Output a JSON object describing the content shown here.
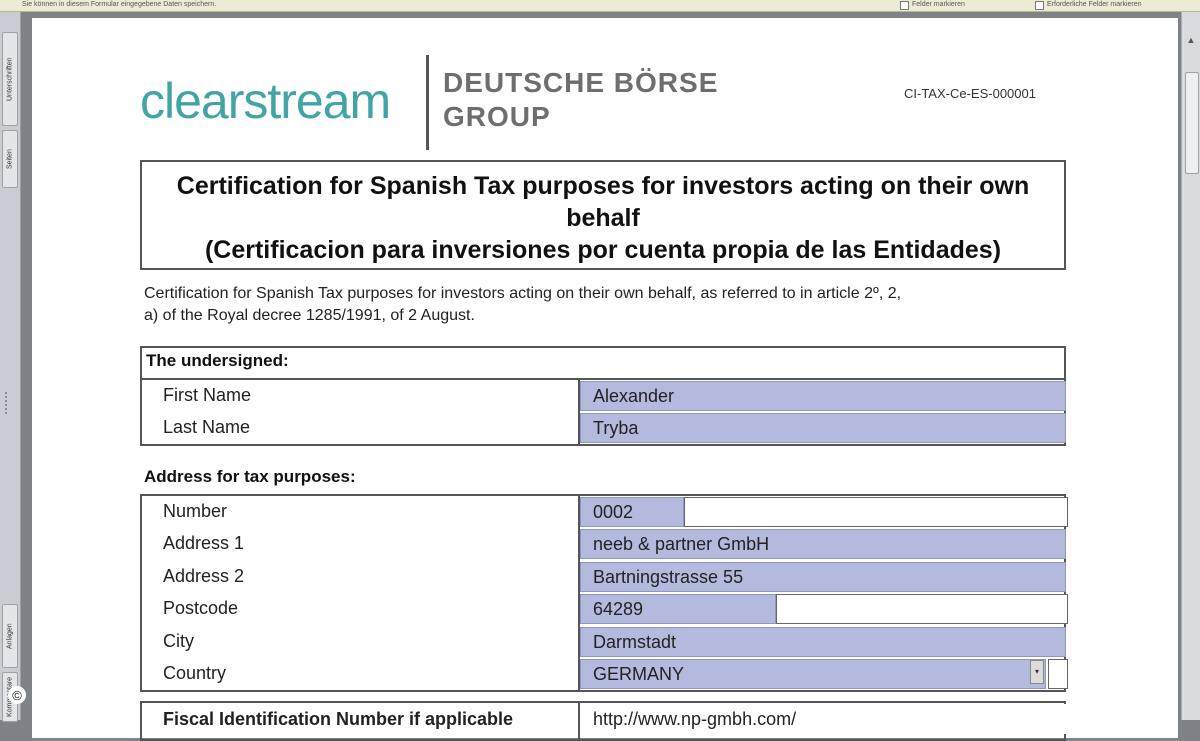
{
  "toolbar": {
    "message": "Sie können in diesem Formular eingegebene Daten speichern.",
    "option1": "Felder markieren",
    "option2": "Erforderliche Felder markieren"
  },
  "side_tabs": [
    "Unterschriften",
    "Seiten",
    "Anlagen",
    "Kommentare"
  ],
  "copyright": "©",
  "header": {
    "logo": "clearstream",
    "group_line1": "DEUTSCHE BÖRSE",
    "group_line2": "GROUP",
    "doc_ref": "CI-TAX-Ce-ES-000001"
  },
  "title": {
    "line1": "Certification for Spanish Tax purposes for investors acting on their own",
    "line2": "behalf",
    "line3": "(Certificacion para inversiones por cuenta propia de las Entidades)"
  },
  "intro": {
    "line1": "Certification for Spanish Tax purposes for investors acting on their own behalf, as referred to in article 2º, 2,",
    "line2": "a) of the Royal decree 1285/1991, of 2 August."
  },
  "undersigned": {
    "heading": "The undersigned:",
    "first_name_label": "First Name",
    "first_name": "Alexander",
    "last_name_label": "Last Name",
    "last_name": "Tryba"
  },
  "address": {
    "heading": "Address for tax purposes:",
    "number_label": "Number",
    "number": "0002",
    "address1_label": "Address 1",
    "address1": "neeb & partner GmbH",
    "address2_label": "Address 2",
    "address2": "Bartningstrasse 55",
    "postcode_label": "Postcode",
    "postcode": "64289",
    "city_label": "City",
    "city": "Darmstadt",
    "country_label": "Country",
    "country": "GERMANY"
  },
  "fiscal": {
    "label": "Fiscal Identification Number if applicable",
    "value": "http://www.np-gmbh.com/"
  },
  "colors": {
    "field_fill": "#b4bade",
    "logo_teal": "#43a4a6"
  }
}
